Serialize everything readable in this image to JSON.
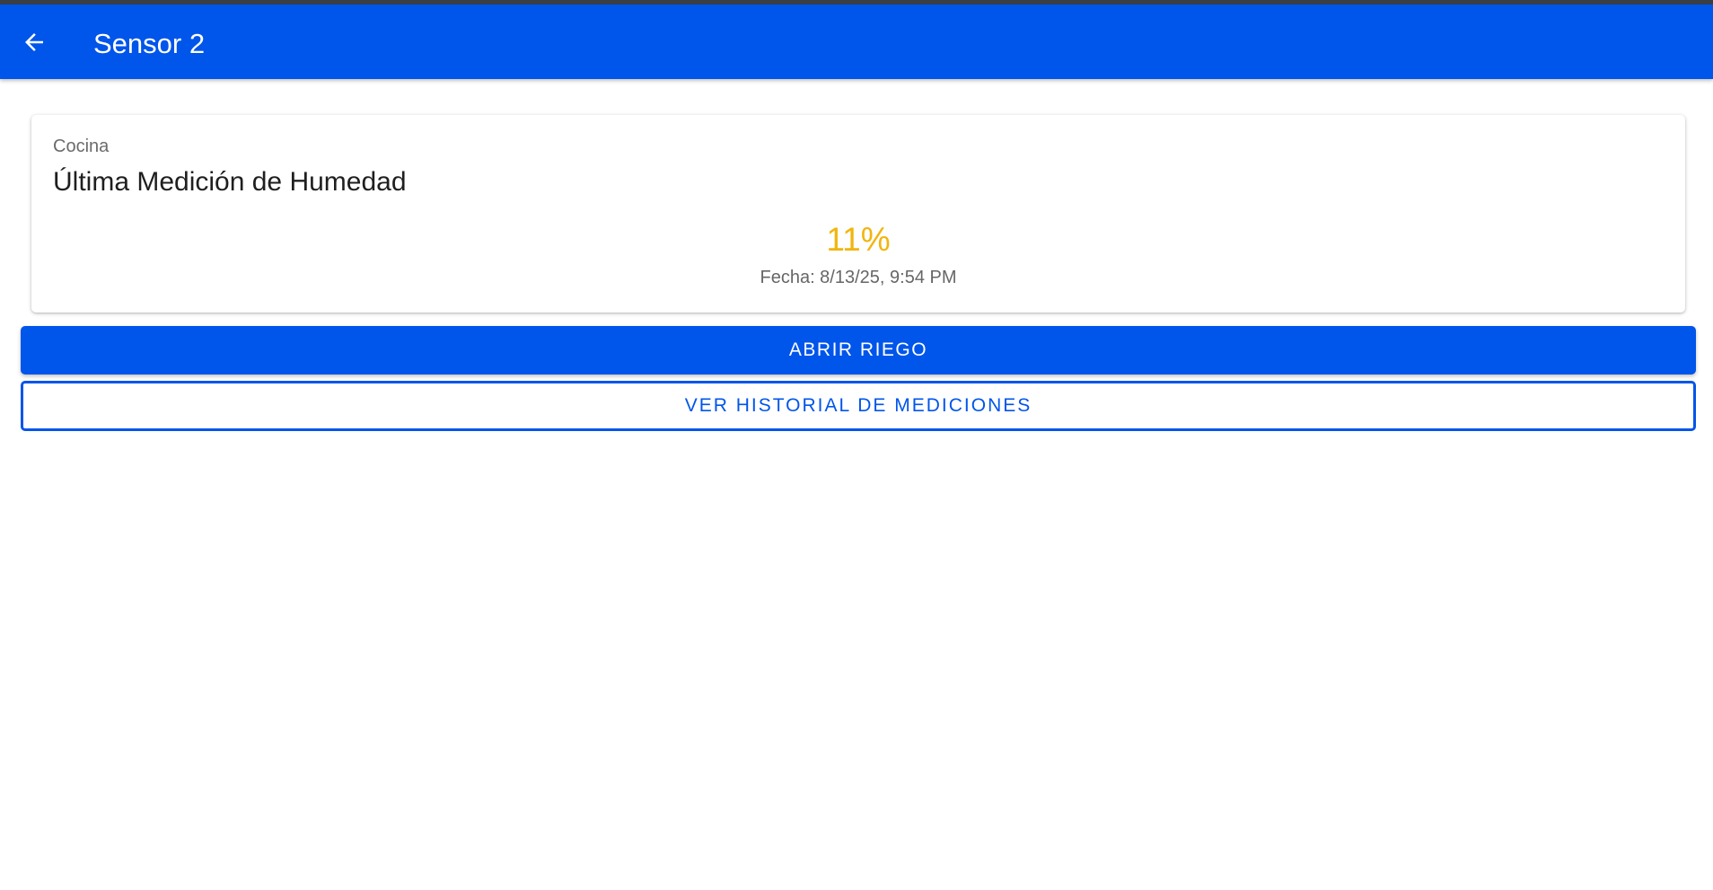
{
  "header": {
    "back_icon": "arrow-left-icon",
    "title": "Sensor 2"
  },
  "card": {
    "location": "Cocina",
    "title": "Última Medición de Humedad",
    "value": "11%",
    "date": "Fecha: 8/13/25, 9:54 PM"
  },
  "actions": {
    "open_irrigation_label": "ABRIR RIEGO",
    "history_label": "VER HISTORIAL DE MEDICIONES"
  },
  "colors": {
    "primary": "#0055ea",
    "value_color": "#f2b50d"
  }
}
